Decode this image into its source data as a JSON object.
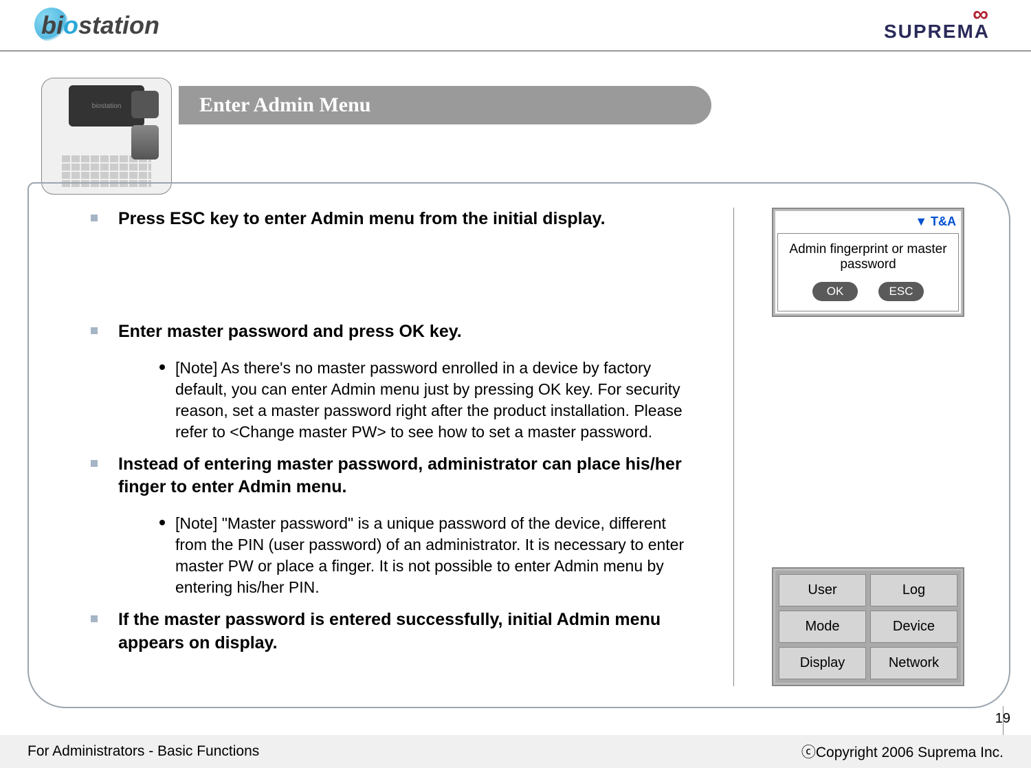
{
  "header": {
    "logo_left": "biostation",
    "logo_right": "SUPREMA"
  },
  "title": "Enter Admin Menu",
  "bullets": {
    "b1": "Press ESC key to enter Admin menu from the initial display.",
    "b2": "Enter master password and press OK key.",
    "b2_note": "[Note] As there's no master password enrolled in a device by factory default, you can enter Admin menu just by pressing OK key. For security reason, set a master password right after the product installation. Please refer to <Change master PW> to see how to set a master password.",
    "b3": "Instead of entering master password, administrator can place his/her finger to enter Admin menu.",
    "b3_note": "[Note] \"Master password\" is a unique password of the device, different from the PIN (user password) of an administrator. It is necessary to enter master PW or place a finger. It is not possible to enter Admin menu by entering his/her PIN.",
    "b4": "If the master password is entered successfully, initial Admin menu appears on display."
  },
  "screen1": {
    "tna": "▼ T&A",
    "msg": "Admin fingerprint or master password",
    "ok": "OK",
    "esc": "ESC"
  },
  "screen2": {
    "items": [
      "User",
      "Log",
      "Mode",
      "Device",
      "Display",
      "Network"
    ]
  },
  "page_number": "19",
  "footer": {
    "left": "For Administrators - Basic Functions",
    "right": "ⓒCopyright 2006 Suprema Inc."
  }
}
